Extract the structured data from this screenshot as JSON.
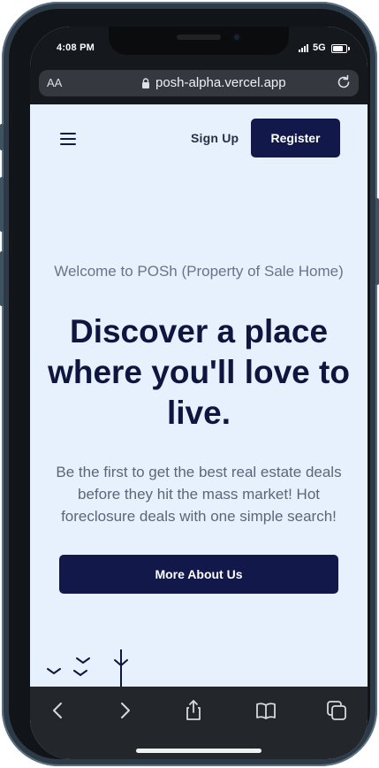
{
  "status_bar": {
    "time": "4:08 PM",
    "network": "5G"
  },
  "browser": {
    "text_size_label": "AA",
    "url": "posh-alpha.vercel.app"
  },
  "nav": {
    "menu_icon": "hamburger-icon",
    "sign_up_label": "Sign Up",
    "register_label": "Register"
  },
  "hero": {
    "welcome": "Welcome to POSh (Property of Sale Home)",
    "headline": "Discover a place where you'll love to live.",
    "description": "Be the first to get the best real estate deals before they hit the mass market! Hot foreclosure deals with one simple search!",
    "cta_label": "More About Us"
  },
  "toolbar": {
    "icons": [
      "back-icon",
      "forward-icon",
      "share-icon",
      "bookmarks-icon",
      "tabs-icon"
    ]
  },
  "colors": {
    "page_background": "#e7f0fd",
    "primary_navy": "#12194a",
    "headline_text": "#0e163f",
    "muted_text": "#6b7487",
    "browser_chrome": "#15181c"
  }
}
